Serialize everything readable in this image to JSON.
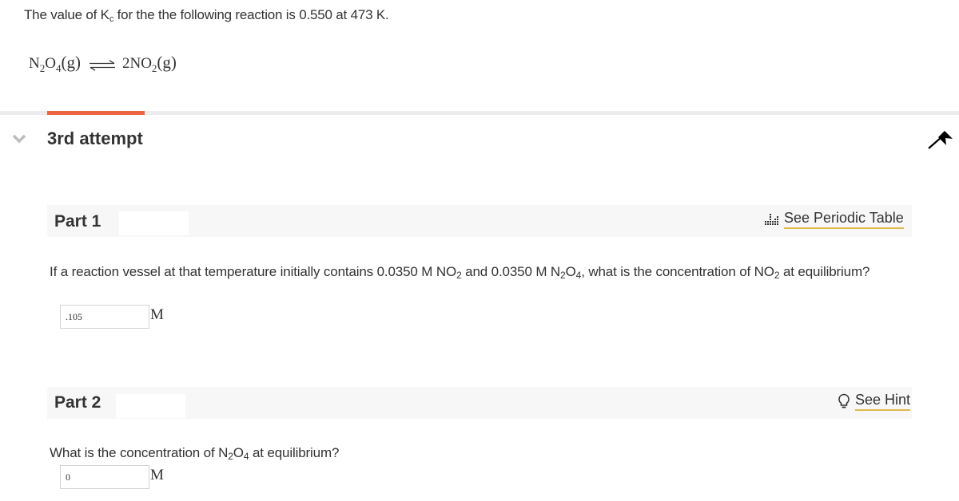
{
  "intro": {
    "prefix": "The value of K",
    "sub": "c",
    "suffix": " for the the following reaction is 0.550 at  473 K."
  },
  "equation": {
    "reactant": {
      "a": "N",
      "s1": "2",
      "b": "O",
      "s2": "4",
      "phase": "(g)"
    },
    "product": {
      "coef": "2NO",
      "s1": "2",
      "phase": "(g)"
    },
    "arrow_icon": "equilibrium-arrow-icon"
  },
  "progress": {
    "fill_fraction": 0.1,
    "fill_color": "#ef6440",
    "track_color": "#ececec"
  },
  "attempt": {
    "label": "3rd attempt",
    "chevron_icon": "chevron-down-icon"
  },
  "pin_icon": "pin-icon",
  "part1": {
    "title": "Part 1",
    "tool": {
      "icon": "periodic-table-icon",
      "label": "See Periodic Table"
    },
    "question": {
      "t1": "If a reaction vessel at that temperature initially contains 0.0350  M NO",
      "s1": "2",
      "t2": " and 0.0350  M N",
      "s2": "2",
      "t3": "O",
      "s3": "4",
      "t4": ", what is the concentration of NO",
      "s4": "2",
      "t5": " at equilibrium?"
    },
    "answer": {
      "value": ".105",
      "unit": "M"
    }
  },
  "part2": {
    "title": "Part 2",
    "tool": {
      "icon": "lightbulb-icon",
      "label": "See Hint"
    },
    "question": {
      "t1": "What is the concentration of N",
      "s1": "2",
      "t2": "O",
      "s2": "4",
      "t3": " at equilibrium?"
    },
    "answer": {
      "value": "0",
      "unit": "M"
    }
  },
  "colors": {
    "accent": "#ef6440",
    "link_underline": "#e0b84a",
    "part_bar": "#f7f7f7",
    "text": "#333333"
  }
}
